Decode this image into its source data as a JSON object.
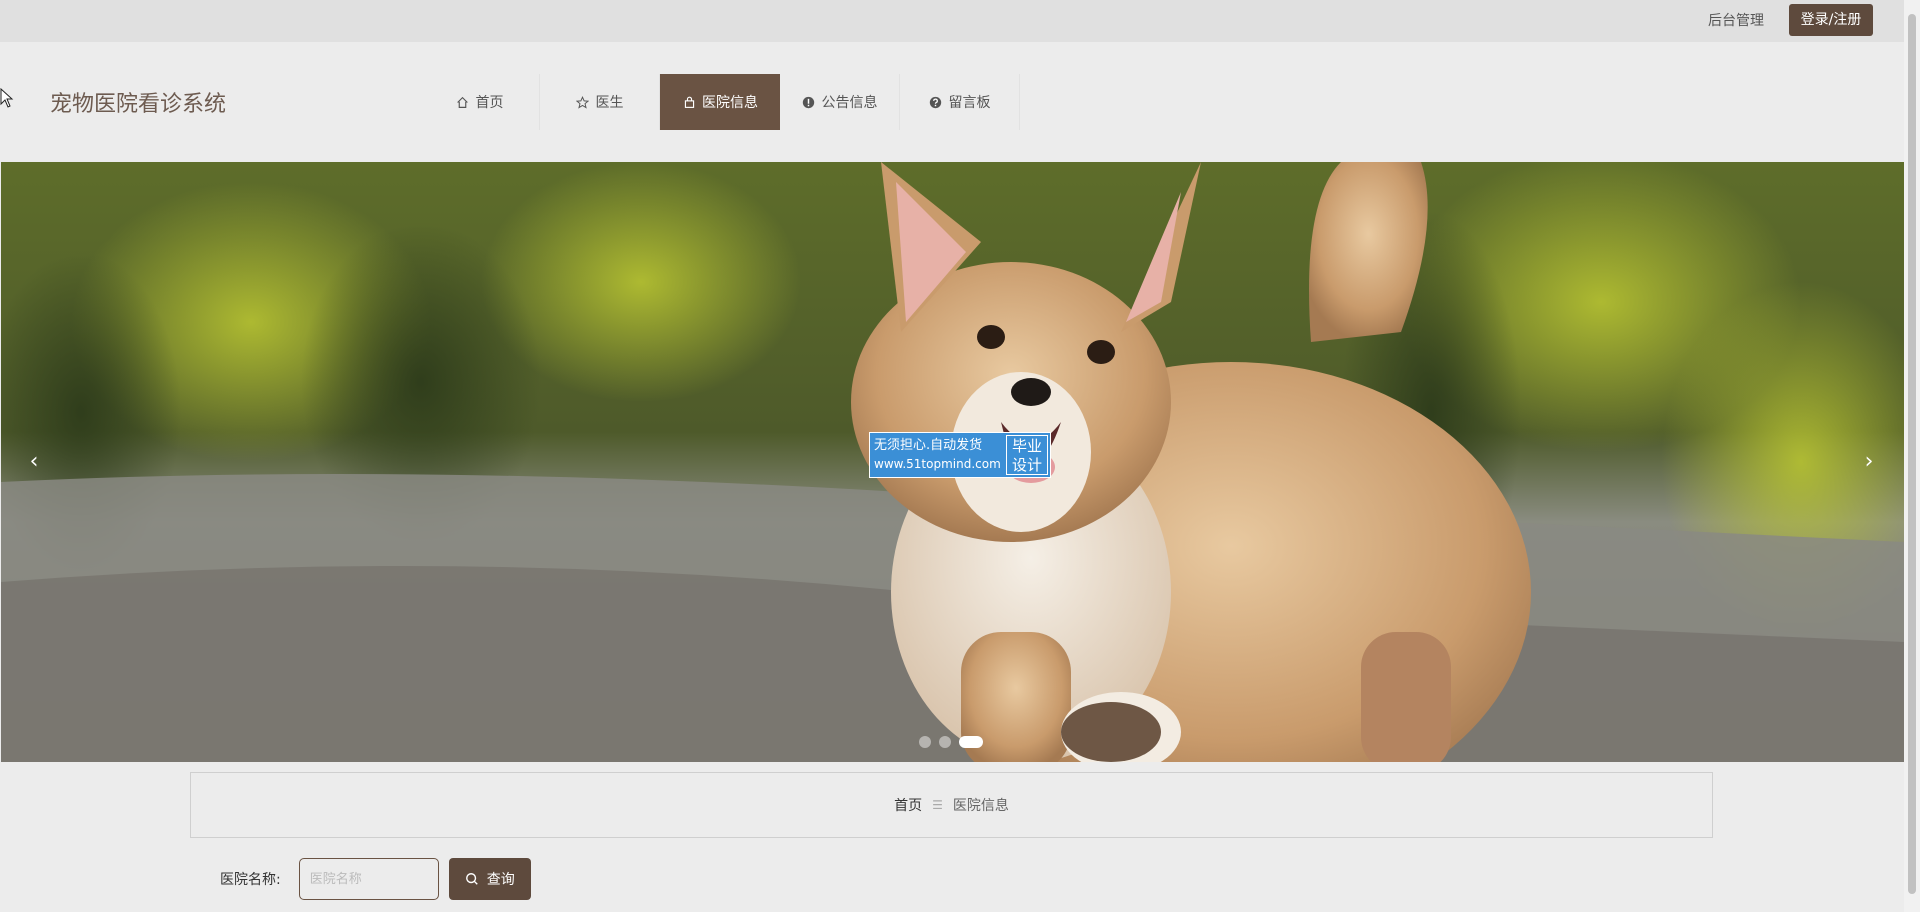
{
  "topbar": {
    "admin_label": "后台管理",
    "login_label": "登录/注册"
  },
  "header": {
    "site_title": "宠物医院看诊系统",
    "nav": [
      {
        "label": "首页",
        "icon": "home-icon"
      },
      {
        "label": "医生",
        "icon": "star-icon"
      },
      {
        "label": "医院信息",
        "icon": "bag-icon",
        "active": true
      },
      {
        "label": "公告信息",
        "icon": "exclamation-icon"
      },
      {
        "label": "留言板",
        "icon": "question-icon"
      }
    ]
  },
  "carousel": {
    "prev_glyph": "‹",
    "next_glyph": "›",
    "slide_count": 3,
    "active_slide": 3,
    "watermark": {
      "line1": "无须担心.自动发货",
      "line2": "www.51topmind.com",
      "side": "毕业设计"
    }
  },
  "breadcrumb": {
    "home": "首页",
    "separator": "☰",
    "current": "医院信息"
  },
  "search": {
    "label": "医院名称:",
    "placeholder": "医院名称",
    "value": "",
    "button_label": "查询"
  },
  "colors": {
    "brand": "#5e4a3d",
    "nav_active": "#6a5343",
    "title": "#6d5b50"
  }
}
